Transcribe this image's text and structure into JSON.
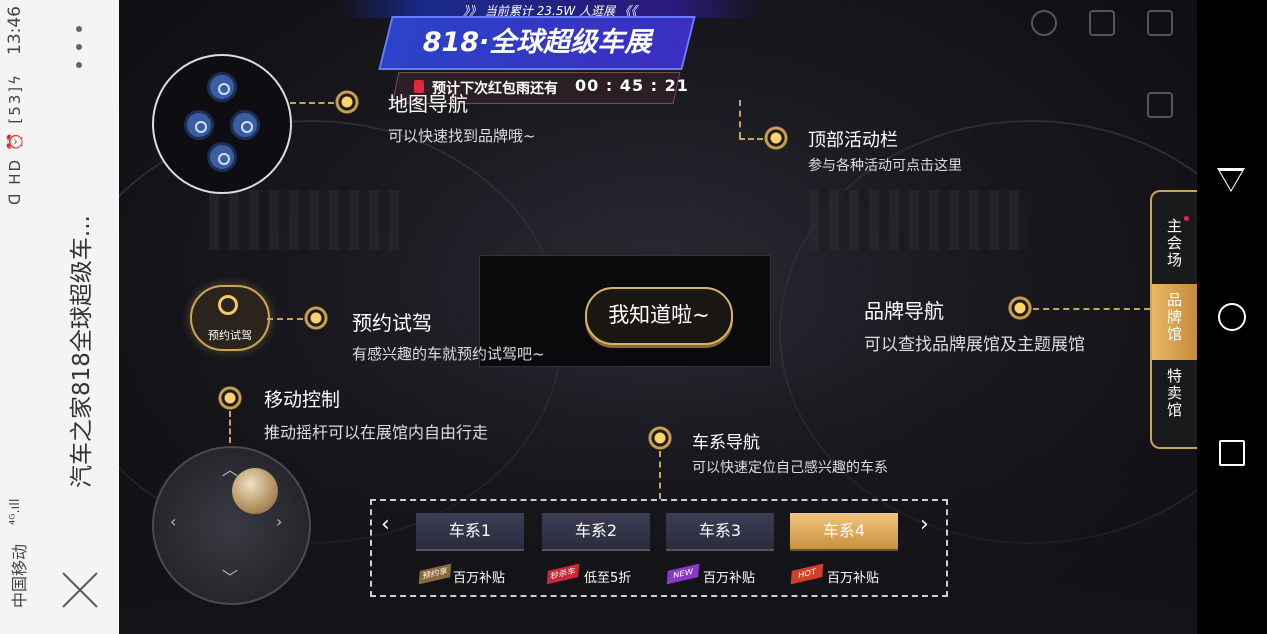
{
  "status_bar": {
    "carrier": "中国移动",
    "network": "⁴ᴳ.ıll",
    "time": "13:46",
    "battery": "53",
    "system_icons": "ᗡ HD ⏰"
  },
  "app": {
    "title": "汽车之家818全球超级车..."
  },
  "banner": {
    "stat_text": "》》 当前累计 23.5W 人逛展 《《",
    "title": "818·全球超级车展",
    "timer_label": "预计下次红包雨还有",
    "timer_value": "00 : 45 : 21"
  },
  "guide": {
    "map": {
      "title": "地图导航",
      "subtitle": "可以快速找到品牌哦~"
    },
    "top_bar": {
      "title": "顶部活动栏",
      "subtitle": "参与各种活动可点击这里"
    },
    "test_drive": {
      "title": "预约试驾",
      "subtitle": "有感兴趣的车就预约试驾吧~",
      "button_label": "预约试驾"
    },
    "brand_nav": {
      "title": "品牌导航",
      "subtitle": "可以查找品牌展馆及主题展馆"
    },
    "movement": {
      "title": "移动控制",
      "subtitle": "推动摇杆可以在展馆内自由行走"
    },
    "series_nav": {
      "title": "车系导航",
      "subtitle": "可以快速定位自己感兴趣的车系"
    },
    "got_it_label": "我知道啦~"
  },
  "series": [
    {
      "label": "车系1",
      "tag": "预约享",
      "tag_color": "#8a6a3a",
      "desc": "百万补贴",
      "active": false
    },
    {
      "label": "车系2",
      "tag": "秒杀车",
      "tag_color": "#c8283a",
      "desc": "低至5折",
      "active": false
    },
    {
      "label": "车系3",
      "tag": "NEW",
      "tag_color": "#8a3ac8",
      "desc": "百万补贴",
      "active": false
    },
    {
      "label": "车系4",
      "tag": "HOT",
      "tag_color": "#d0402a",
      "desc": "百万补贴",
      "active": true
    }
  ],
  "series_nav_arrows": {
    "prev": "‹",
    "next": "›"
  },
  "side_tabs": [
    {
      "label": "主会场"
    },
    {
      "label": "品牌馆"
    },
    {
      "label": "特卖馆"
    }
  ],
  "icons": {
    "profile": "profile-icon",
    "share": "share-icon",
    "sound": "sound-icon",
    "edit": "edit-icon"
  }
}
